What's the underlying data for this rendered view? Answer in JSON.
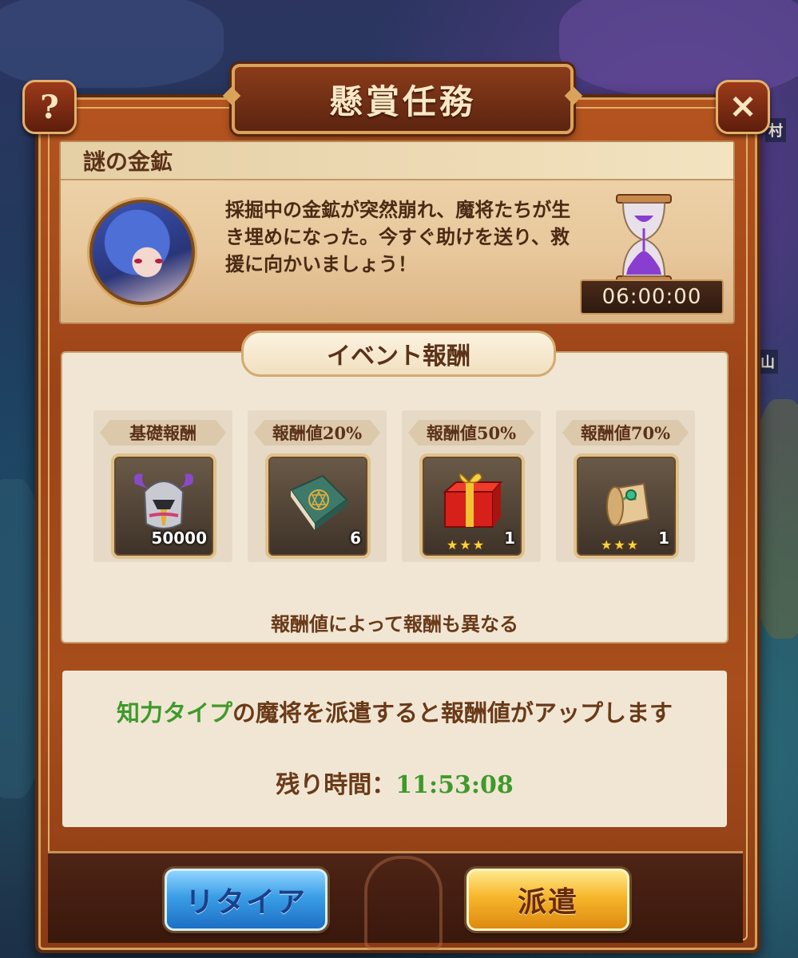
{
  "dialog": {
    "title": "懸賞任務",
    "help_icon": "?",
    "close_icon": "✕"
  },
  "map_labels": [
    "村",
    "山"
  ],
  "mission": {
    "name": "謎の金鉱",
    "description": "採掘中の金鉱が突然崩れ、魔将たちが生き埋めになった。今すぐ助けを送り、救援に向かいましょう！",
    "duration": "06:00:00",
    "hourglass_icon": "hourglass-icon"
  },
  "rewards": {
    "title": "イベント報酬",
    "items": [
      {
        "tag": "基礎報酬",
        "icon": "helmet-icon",
        "qty": "50000",
        "stars": ""
      },
      {
        "tag": "報酬値20%",
        "icon": "book-icon",
        "qty": "6",
        "stars": ""
      },
      {
        "tag": "報酬値50%",
        "icon": "gift-box-icon",
        "qty": "1",
        "stars": "★★★"
      },
      {
        "tag": "報酬値70%",
        "icon": "scroll-icon",
        "qty": "1",
        "stars": "★★★"
      }
    ],
    "note": "報酬値によって報酬も異なる"
  },
  "dispatch": {
    "hint_highlight": "知力タイプ",
    "hint_rest": "の魔将を派遣すると報酬値がアップします",
    "time_label": "残り時間：",
    "time_value": "11:53:08"
  },
  "buttons": {
    "retire": "リタイア",
    "dispatch": "派遣"
  },
  "colors": {
    "highlight_green": "#3e9a2a",
    "text_brown": "#6a3a18",
    "frame_orange": "#b5541f"
  }
}
